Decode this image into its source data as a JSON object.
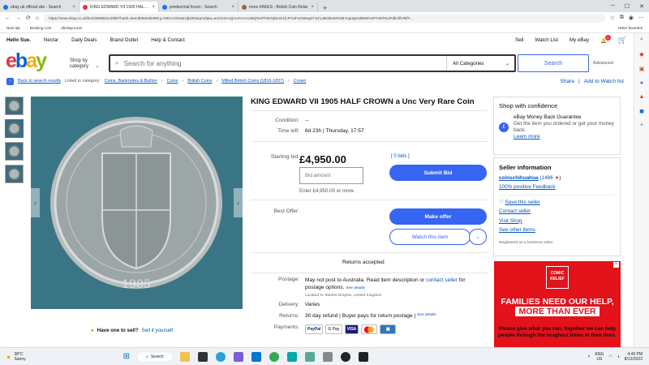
{
  "browser": {
    "tabs": [
      {
        "title": "ebay uk official site - Search",
        "active": false
      },
      {
        "title": "KING EDWARD VII 1905 HALF CR",
        "active": true
      },
      {
        "title": "predecimal forum - Search",
        "active": false
      },
      {
        "title": "more FAKES - British Coin Relat",
        "active": false
      }
    ],
    "url": "https://www.ebay.co.uk/itm/255868114069?hash=item3b92ed9495:g:A90AAOSw51tjkZ8S&amdata=enc%3AAQAHAAAAoMQ%2FhXK5jNmG1fcF%2FuOWeq5YXZ1J80Jkm8%2BYuje3g%2B93%2FFeDh%2FdkGfh7BfY...",
    "bookmarks": [
      "New tab",
      "Booking.com",
      "dlinkap.local"
    ],
    "other_favorites": "Other favorites"
  },
  "header": {
    "greeting": "Hello Sue.",
    "nav": [
      "Nectar",
      "Daily Deals",
      "Brand Outlet",
      "Help & Contact"
    ],
    "right": {
      "sell": "Sell",
      "watch": "Watch List",
      "myebay": "My eBay",
      "notif_count": "1"
    },
    "logo": {
      "e": "e",
      "b": "b",
      "a": "a",
      "y": "y"
    },
    "shop_by": "Shop by category",
    "search_placeholder": "Search for anything",
    "category": "All Categories",
    "search_button": "Search",
    "advanced": "Advanced"
  },
  "breadcrumb": {
    "back": "Back to search results",
    "listed": "Listed in category:",
    "items": [
      "Coins, Banknotes & Bullion",
      "Coins",
      "British Coins",
      "Milled British Coins (1816-1837)",
      "Crown"
    ],
    "share": "Share",
    "add_watch": "Add to Watch list"
  },
  "gallery": {
    "thumbnail_count": 4,
    "sell_question": "Have one to sell?",
    "sell_link": "Sell it yourself"
  },
  "item": {
    "title": "KING EDWARD VII 1905 HALF CROWN a Unc Very Rare Coin",
    "condition_label": "Condition:",
    "condition_value": "--",
    "time_left_label": "Time left:",
    "time_left_value": "6d 23h | Thursday, 17:57",
    "starting_bid_label": "Starting bid:",
    "price": "£4,950.00",
    "bids": "[ 0 bids ]",
    "bid_placeholder": "Bid amount",
    "enter_hint": "Enter £4,950.00 or more",
    "submit_bid": "Submit Bid",
    "best_offer_label": "Best Offer:",
    "make_offer": "Make offer",
    "watch_item": "Watch this item",
    "returns_accepted": "Returns accepted",
    "postage_label": "Postage:",
    "postage_text": "May not post to Australia. Read item description or",
    "contact_seller": "contact seller",
    "postage_text2": "for postage options.",
    "see_details": "See details",
    "located": "Located in: Market Drayton, United Kingdom",
    "delivery_label": "Delivery:",
    "delivery_value": "Varies",
    "returns_label": "Returns:",
    "returns_value": "30 day refund | Buyer pays for return postage |",
    "payments_label": "Payments:",
    "payments": [
      "PayPal",
      "G Pay",
      "VISA",
      "MC",
      "AMEX"
    ]
  },
  "confidence": {
    "title": "Shop with confidence",
    "guarantee_title": "eBay Money Back Guarantee",
    "guarantee_text": "Get the item you ordered or get your money back.",
    "learn_more": "Learn more"
  },
  "seller": {
    "title": "Seller information",
    "name": "coinschihuahua",
    "feedback_score": "(1486",
    "positive": "100% positive Feedback",
    "save": "Save this seller",
    "contact": "Contact seller",
    "visit": "Visit Shop",
    "other": "See other items",
    "business": "Registered as a business seller"
  },
  "ad": {
    "logo": "COMIC RELIEF",
    "headline1": "FAMILIES NEED OUR HELP,",
    "headline2": "MORE THAN EVER",
    "body": "Please give what you can, together we can help people through the toughest times in their lives."
  },
  "taskbar": {
    "weather_temp": "38°C",
    "weather_desc": "Sunny",
    "search": "Search",
    "lang1": "ENG",
    "lang2": "US",
    "time": "4:49 PM",
    "date": "8/12/2022"
  }
}
